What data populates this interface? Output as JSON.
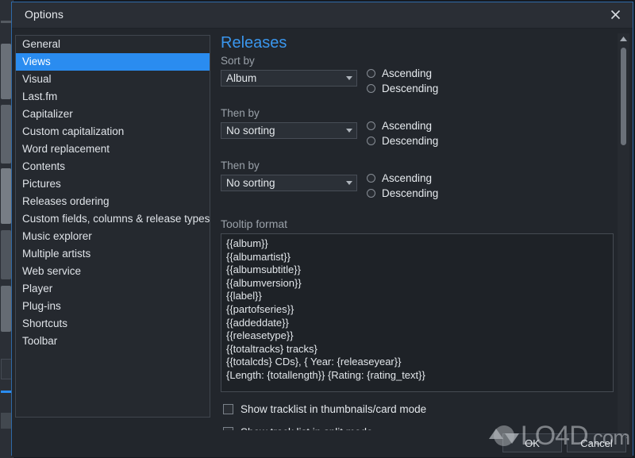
{
  "window": {
    "title": "Options",
    "close_icon": "close-icon"
  },
  "sidebar": {
    "items": [
      {
        "label": "General",
        "selected": false
      },
      {
        "label": "Views",
        "selected": true
      },
      {
        "label": "Visual",
        "selected": false
      },
      {
        "label": "Last.fm",
        "selected": false
      },
      {
        "label": "Capitalizer",
        "selected": false
      },
      {
        "label": "Custom capitalization",
        "selected": false
      },
      {
        "label": "Word replacement",
        "selected": false
      },
      {
        "label": "Contents",
        "selected": false
      },
      {
        "label": "Pictures",
        "selected": false
      },
      {
        "label": "Releases ordering",
        "selected": false
      },
      {
        "label": "Custom fields, columns & release types",
        "selected": false
      },
      {
        "label": "Music explorer",
        "selected": false
      },
      {
        "label": "Multiple artists",
        "selected": false
      },
      {
        "label": "Web service",
        "selected": false
      },
      {
        "label": "Player",
        "selected": false
      },
      {
        "label": "Plug-ins",
        "selected": false
      },
      {
        "label": "Shortcuts",
        "selected": false
      },
      {
        "label": "Toolbar",
        "selected": false
      }
    ]
  },
  "content": {
    "heading": "Releases",
    "sort_rows": [
      {
        "label": "Sort by",
        "value": "Album",
        "ascending_label": "Ascending",
        "descending_label": "Descending",
        "ascending_checked": false,
        "descending_checked": false
      },
      {
        "label": "Then by",
        "value": "No sorting",
        "ascending_label": "Ascending",
        "descending_label": "Descending",
        "ascending_checked": false,
        "descending_checked": false
      },
      {
        "label": "Then by",
        "value": "No sorting",
        "ascending_label": "Ascending",
        "descending_label": "Descending",
        "ascending_checked": false,
        "descending_checked": false
      }
    ],
    "tooltip_section_label": "Tooltip format",
    "tooltip_lines": [
      "{{album}}",
      "{{albumartist}}",
      "{{albumsubtitle}}",
      "{{albumversion}}",
      "{{label}}",
      "{{partofseries}}",
      "{{addeddate}}",
      "{{releasetype}}",
      "{{totaltracks} tracks}",
      "{{totalcds} CDs}, { Year: {releaseyear}}",
      "{Length: {totallength}} {Rating: {rating_text}}"
    ],
    "checkboxes": [
      {
        "label": "Show tracklist in thumbnails/card mode",
        "checked": false
      },
      {
        "label": "Show track list in split mode",
        "checked": false
      }
    ]
  },
  "footer": {
    "ok_label": "OK",
    "cancel_label": "Cancel"
  },
  "watermark": {
    "text_main": "LO4D",
    "text_suffix": ".com"
  },
  "colors": {
    "accent_selection": "#2a8cf0",
    "heading": "#3a96ed",
    "window_bg": "#22262c",
    "border": "#2f6aa8"
  }
}
